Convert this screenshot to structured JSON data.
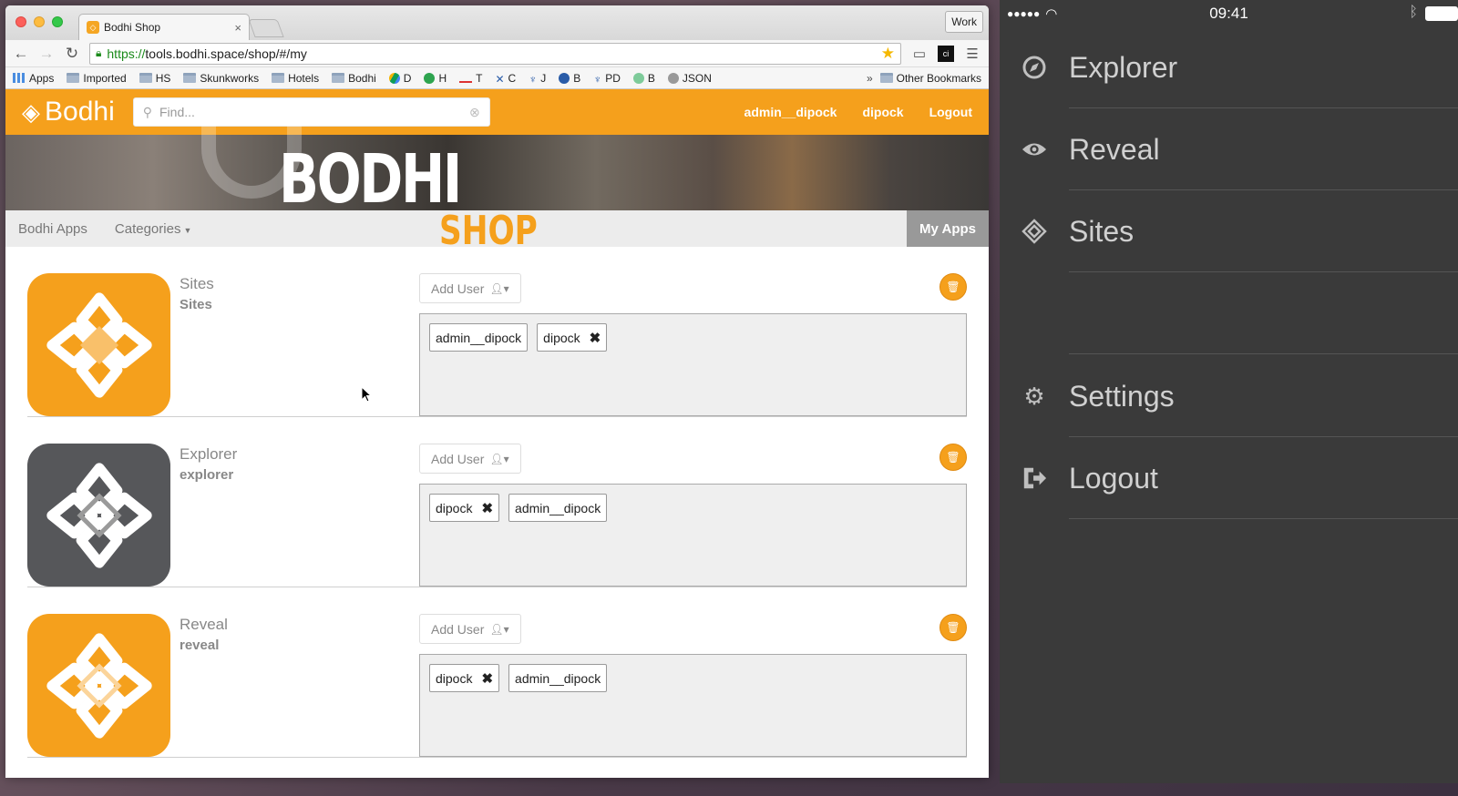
{
  "browser": {
    "tab_title": "Bodhi Shop",
    "tab_close": "×",
    "profile_button": "Work",
    "url_https": "https://",
    "url_rest": "tools.bodhi.space/shop/#/my",
    "bookmarks": [
      {
        "label": "Apps",
        "icon": "apps-grid-icon"
      },
      {
        "label": "Imported",
        "icon": "folder-icon"
      },
      {
        "label": "HS",
        "icon": "folder-icon"
      },
      {
        "label": "Skunkworks",
        "icon": "folder-icon"
      },
      {
        "label": "Hotels",
        "icon": "folder-icon"
      },
      {
        "label": "Bodhi",
        "icon": "folder-icon"
      },
      {
        "label": "D",
        "icon": "drive-icon"
      },
      {
        "label": "H",
        "icon": "green-dot-icon"
      },
      {
        "label": "T",
        "icon": "red-line-icon"
      },
      {
        "label": "C",
        "icon": "tools-icon"
      },
      {
        "label": "J",
        "icon": "jira-icon"
      },
      {
        "label": "B",
        "icon": "badge-icon"
      },
      {
        "label": "PD",
        "icon": "pd-icon"
      },
      {
        "label": "B",
        "icon": "cloud-icon"
      },
      {
        "label": "JSON",
        "icon": "globe-icon"
      }
    ],
    "bookmarks_more": "»",
    "other_bookmarks": "Other Bookmarks"
  },
  "app": {
    "logo_text": "Bodhi",
    "search_placeholder": "Find...",
    "header_links": [
      "admin__dipock",
      "dipock",
      "Logout"
    ],
    "banner_title": "BODHI",
    "banner_sub": "SHOP",
    "subnav": {
      "bodhi_apps": "Bodhi Apps",
      "categories": "Categories",
      "my_apps": "My Apps"
    },
    "add_user_label": "Add User",
    "apps": [
      {
        "name": "Sites",
        "id": "Sites",
        "color": "#f5a01c",
        "users": [
          {
            "name": "admin__dipock",
            "removable": false
          },
          {
            "name": "dipock",
            "removable": true
          }
        ]
      },
      {
        "name": "Explorer",
        "id": "explorer",
        "color": "#56575a",
        "users": [
          {
            "name": "dipock",
            "removable": true
          },
          {
            "name": "admin__dipock",
            "removable": false
          }
        ]
      },
      {
        "name": "Reveal",
        "id": "reveal",
        "color": "#f5a01c",
        "users": [
          {
            "name": "dipock",
            "removable": true
          },
          {
            "name": "admin__dipock",
            "removable": false
          }
        ]
      }
    ]
  },
  "phone": {
    "time": "09:41",
    "menu": [
      {
        "label": "Explorer",
        "icon": "compass-icon"
      },
      {
        "label": "Reveal",
        "icon": "eye-icon"
      },
      {
        "label": "Sites",
        "icon": "bodhi-diamond-icon"
      },
      {
        "label": "",
        "icon": ""
      },
      {
        "label": "Settings",
        "icon": "gear-icon"
      },
      {
        "label": "Logout",
        "icon": "logout-icon"
      }
    ]
  },
  "colors": {
    "brand_orange": "#f5a01c",
    "phone_bg": "#3a3a3a"
  }
}
